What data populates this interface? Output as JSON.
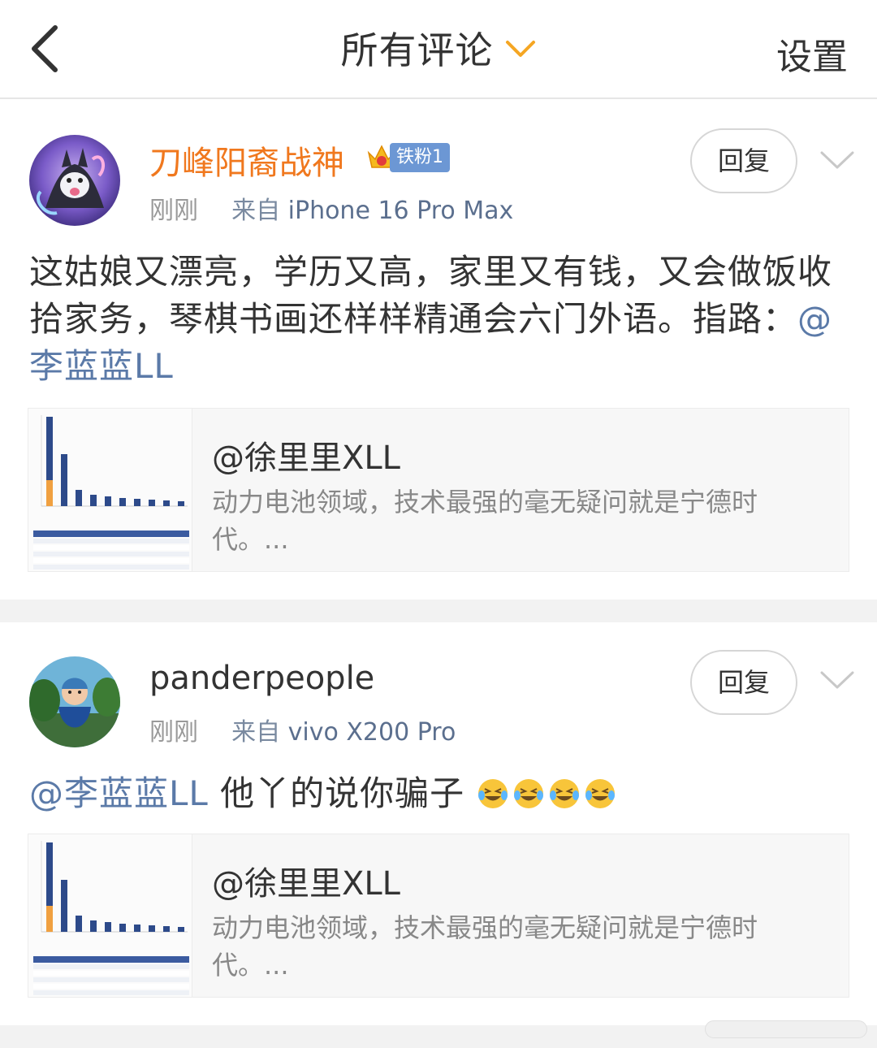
{
  "header": {
    "title": "所有评论",
    "settings_label": "设置",
    "back_icon": "chevron-left-icon",
    "title_dropdown_icon": "chevron-down-icon"
  },
  "comments": [
    {
      "username": "刀峰阳裔战神",
      "username_color": "#f0781e",
      "badge": "铁粉1",
      "time": "刚刚",
      "from_label": "来自",
      "device": "iPhone 16 Pro Max",
      "reply_label": "回复",
      "text_plain": "这姑娘又漂亮，学历又高，家里又有钱，又会做饭收拾家务，琴棋书画还样样精通会六门外语。指路：",
      "mention": "@李蓝蓝LL",
      "card": {
        "title": "@徐里里XLL",
        "desc": "动力电池领域，技术最强的毫无疑问就是宁德时代。..."
      }
    },
    {
      "username": "panderpeople",
      "username_color": "#333333",
      "time": "刚刚",
      "from_label": "来自",
      "device": "vivo X200 Pro",
      "reply_label": "回复",
      "mention": "@李蓝蓝LL",
      "text_plain": " 他丫的说你骗子",
      "emoji_name": "laughing-tears-emoji",
      "emoji_count": 4,
      "card": {
        "title": "@徐里里XLL",
        "desc": "动力电池领域，技术最强的毫无疑问就是宁德时代。..."
      }
    }
  ],
  "colors": {
    "mention": "#5b7aa8",
    "accent_orange": "#f0781e",
    "chevron_orange": "#f5a623"
  }
}
